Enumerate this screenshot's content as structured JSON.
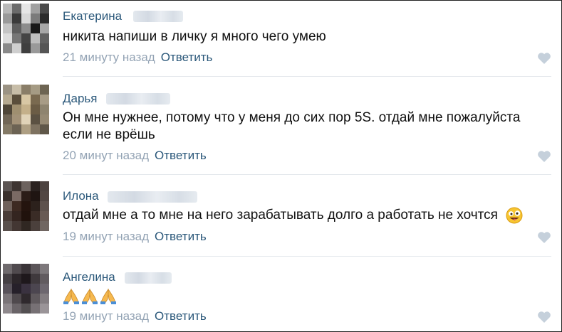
{
  "comments": [
    {
      "author": "Екатерина",
      "text": "никита напиши в личку я много чего умею",
      "time": "21 минуту назад",
      "reply_label": "Ответить",
      "avatar_colors": [
        "#b8b8b8",
        "#6b6b6b",
        "#e6e6e6",
        "#a0a0a0",
        "#4a4a4a",
        "#9a9a9a",
        "#3a3a3a",
        "#d8d8d8",
        "#7b7b7b",
        "#2b2b2b",
        "#c4c4c4",
        "#5e5e5e",
        "#8c8c8c",
        "#181818",
        "#a8a8a8",
        "#dcdcdc",
        "#777777",
        "#454545",
        "#bdbdbd",
        "#626262",
        "#8a8a8a",
        "#cfcfcf",
        "#3f3f3f",
        "#999999",
        "#555555"
      ]
    },
    {
      "author": "Дарья",
      "text": "Он мне нужнее, потому что у меня до сих пор 5S. отдай мне пожалуйста если не врёшь",
      "time": "20 минут назад",
      "reply_label": "Ответить",
      "avatar_colors": [
        "#9b9384",
        "#c7bda8",
        "#8a7e68",
        "#a59b84",
        "#6d6452",
        "#b6aa91",
        "#5a4e3c",
        "#d8c7a4",
        "#7a6a50",
        "#a89c86",
        "#4f4638",
        "#9f8f70",
        "#c4b08a",
        "#6b5c45",
        "#8e846f",
        "#716656",
        "#a39278",
        "#e0d3b8",
        "#5b5142",
        "#968a74",
        "#847a66",
        "#6c6354",
        "#ae9f83",
        "#7e7260",
        "#5f5749"
      ]
    },
    {
      "author": "Илона",
      "text": "отдай мне а то мне на него зарабатывать долго а работать не хочтся",
      "time": "19 минут назад",
      "reply_label": "Ответить",
      "avatar_colors": [
        "#5b5452",
        "#3e3532",
        "#6c625e",
        "#2a2220",
        "#4d4340",
        "#3a302c",
        "#7a6a64",
        "#2b1d18",
        "#1f1512",
        "#514642",
        "#6f615b",
        "#3d2a22",
        "#24140e",
        "#2c211c",
        "#5e524d",
        "#4a3d38",
        "#342520",
        "#20120c",
        "#3a2c26",
        "#685a54",
        "#59504c",
        "#433733",
        "#302722",
        "#4b403c",
        "#706661"
      ]
    },
    {
      "author": "Ангелина",
      "text": "",
      "time": "19 минут назад",
      "reply_label": "Ответить",
      "avatar_colors": [
        "#6f6a6d",
        "#504a4e",
        "#3a3438",
        "#5b5559",
        "#7d787b",
        "#454044",
        "#2c262a",
        "#1e181c",
        "#3f393d",
        "#615b5f",
        "#58525a",
        "#26202a",
        "#3a3240",
        "#4c4650",
        "#6d676f",
        "#7a7478",
        "#4f494d",
        "#2f292d",
        "#5f595d",
        "#837d81",
        "#8f898d",
        "#6a6468",
        "#545052",
        "#777175",
        "#9a9498"
      ]
    }
  ]
}
